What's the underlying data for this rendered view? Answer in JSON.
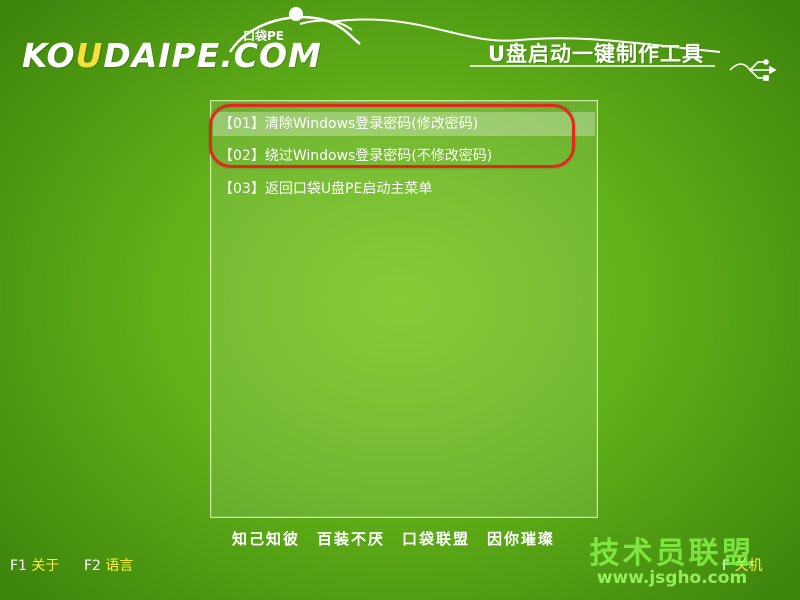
{
  "header": {
    "logo_main": "KO",
    "logo_accent": "U",
    "logo_rest": "DAIPE.COM",
    "logo_badge": "口袋PE",
    "title": "U盘启动一键制作工具",
    "usb_icon": "usb-icon"
  },
  "menu": {
    "items": [
      {
        "label": "【01】清除Windows登录密码(修改密码)",
        "selected": true
      },
      {
        "label": "【02】绕过Windows登录密码(不修改密码)",
        "selected": false
      },
      {
        "label": "【03】返回口袋U盘PE启动主菜单",
        "selected": false
      }
    ]
  },
  "slogan": "知己知彼　百装不厌　口袋联盟　因你璀璨",
  "footer": {
    "f1_key": "F1",
    "f1_label": "关于",
    "f2_key": "F2",
    "f2_label": "语言",
    "f_right_key": "F",
    "f_right_label": "关机"
  },
  "watermark": {
    "big": "技术员联盟",
    "small": "www.jsgho.com"
  },
  "colors": {
    "background": "#63b11a",
    "highlight_ring": "#e0281e",
    "footer_value": "#ffef3a"
  }
}
